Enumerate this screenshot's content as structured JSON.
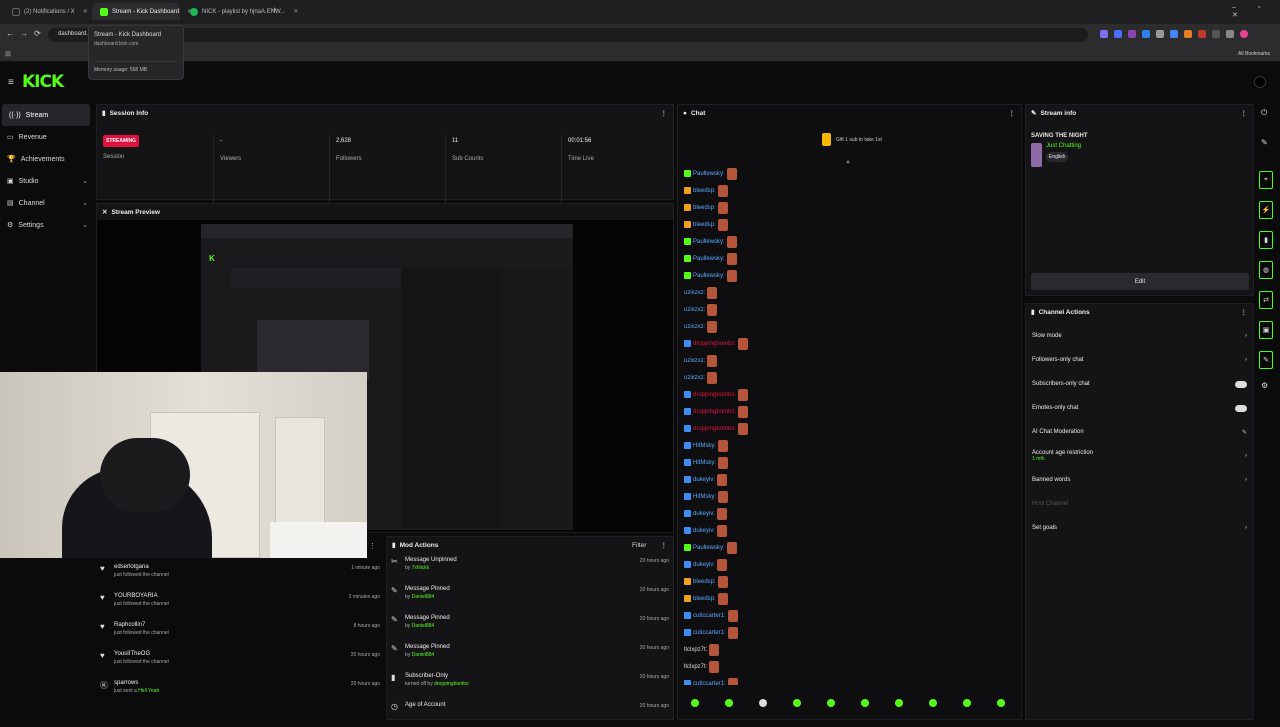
{
  "browser": {
    "tabs": [
      {
        "title": "(2) Notifications / X"
      },
      {
        "title": "Stream - Kick Dashboard"
      },
      {
        "title": "NICK - playlist by hjnaA.ENW..."
      }
    ],
    "url": "dashboard.ki",
    "bookmarks_label": "All Bookmarks",
    "tooltip": {
      "title": "Stream - Kick Dashboard",
      "url": "dashboard.kick.com",
      "memory": "Memory usage: 558 MB"
    }
  },
  "app": {
    "logo": "KICK"
  },
  "sidebar": {
    "items": [
      {
        "label": "Stream"
      },
      {
        "label": "Revenue"
      },
      {
        "label": "Achievements"
      },
      {
        "label": "Studio"
      },
      {
        "label": "Channel"
      },
      {
        "label": "Settings"
      }
    ]
  },
  "session": {
    "title": "Session Info",
    "status": "STREAMING",
    "stats": [
      {
        "value": "",
        "label": "Session"
      },
      {
        "value": "-",
        "label": "Viewers"
      },
      {
        "value": "2,628",
        "label": "Followers"
      },
      {
        "value": "11",
        "label": "Sub Counts"
      },
      {
        "value": "00:01:56",
        "label": "Time Live"
      }
    ]
  },
  "preview": {
    "title": "Stream Preview"
  },
  "activity": [
    {
      "name": "edserlotgana",
      "desc": "just followed the channel",
      "time": "1 minute ago"
    },
    {
      "name": "YOURBOYARIA",
      "desc": "just followed the channel",
      "time": "2 minutes ago"
    },
    {
      "name": "Raphcollin7",
      "desc": "just followed the channel",
      "time": "8 hours ago"
    },
    {
      "name": "YousIITheOG",
      "desc": "just followed the channel",
      "time": "20 hours ago"
    },
    {
      "name": "sparrows",
      "desc": "just sent a",
      "extra": "Hell Yeah",
      "time": "20 hours ago"
    }
  ],
  "mod_actions": {
    "title": "Mod Actions",
    "filter": "Filter",
    "items": [
      {
        "action": "Message Unpinned",
        "by_prefix": "by",
        "by": "7xNickk",
        "time": "20 hours ago"
      },
      {
        "action": "Message Pinned",
        "by_prefix": "by",
        "by": "Daniel884",
        "time": "20 hours ago"
      },
      {
        "action": "Message Pinned",
        "by_prefix": "by",
        "by": "Daniel884",
        "time": "20 hours ago"
      },
      {
        "action": "Message Pinned",
        "by_prefix": "by",
        "by": "Daniel884",
        "time": "20 hours ago"
      },
      {
        "action": "Subscriber-Only",
        "by_prefix": "turned off by",
        "by": "droppingbombs",
        "time": "20 hours ago"
      },
      {
        "action": "Age of Account",
        "by_prefix": "",
        "by": "",
        "time": "20 hours ago"
      }
    ]
  },
  "chat": {
    "title": "Chat",
    "gift": "Gift 1 sub to take 1st",
    "messages": [
      {
        "user": "Paullewsky:",
        "color": "#5aa9ff",
        "badge": "#53fc18"
      },
      {
        "user": "bleedsp:",
        "color": "#5aa9ff",
        "badge": "#f0a020"
      },
      {
        "user": "bleedsp:",
        "color": "#5aa9ff",
        "badge": "#f0a020"
      },
      {
        "user": "bleedsp:",
        "color": "#5aa9ff",
        "badge": "#f0a020"
      },
      {
        "user": "Paullewsky:",
        "color": "#5aa9ff",
        "badge": "#53fc18"
      },
      {
        "user": "Paullewsky:",
        "color": "#5aa9ff",
        "badge": "#53fc18"
      },
      {
        "user": "Paullewsky:",
        "color": "#5aa9ff",
        "badge": "#53fc18"
      },
      {
        "user": "uzixzxz:",
        "color": "#5aa9ff",
        "badge": ""
      },
      {
        "user": "uzixzxz:",
        "color": "#5aa9ff",
        "badge": ""
      },
      {
        "user": "uzixzxz:",
        "color": "#5aa9ff",
        "badge": ""
      },
      {
        "user": "droppingbombs:",
        "color": "#e0103f",
        "badge": "#3d8df5"
      },
      {
        "user": "uzixzxz:",
        "color": "#5aa9ff",
        "badge": ""
      },
      {
        "user": "uzixzxz:",
        "color": "#5aa9ff",
        "badge": ""
      },
      {
        "user": "droppingbombs:",
        "color": "#e0103f",
        "badge": "#3d8df5"
      },
      {
        "user": "droppingbombs:",
        "color": "#e0103f",
        "badge": "#3d8df5"
      },
      {
        "user": "droppingbombs:",
        "color": "#e0103f",
        "badge": "#3d8df5"
      },
      {
        "user": "HitMsky:",
        "color": "#5aa9ff",
        "badge": "#3d8df5"
      },
      {
        "user": "HitMsky:",
        "color": "#5aa9ff",
        "badge": "#3d8df5"
      },
      {
        "user": "dukeyiv:",
        "color": "#5aa9ff",
        "badge": "#3d8df5"
      },
      {
        "user": "HitMsky:",
        "color": "#5aa9ff",
        "badge": "#3d8df5"
      },
      {
        "user": "dukeyiv:",
        "color": "#5aa9ff",
        "badge": "#3d8df5"
      },
      {
        "user": "dukeyiv:",
        "color": "#5aa9ff",
        "badge": "#3d8df5"
      },
      {
        "user": "Paullewsky:",
        "color": "#5aa9ff",
        "badge": "#53fc18"
      },
      {
        "user": "dukeyiv:",
        "color": "#5aa9ff",
        "badge": "#3d8df5"
      },
      {
        "user": "bleedsp:",
        "color": "#5aa9ff",
        "badge": "#f0a020"
      },
      {
        "user": "bleedsp:",
        "color": "#5aa9ff",
        "badge": "#f0a020"
      },
      {
        "user": "cuticcarter1:",
        "color": "#5aa9ff",
        "badge": "#3d8df5"
      },
      {
        "user": "cuticcarter1:",
        "color": "#5aa9ff",
        "badge": "#3d8df5"
      },
      {
        "user": "ltclxpz7t:",
        "color": "#ddd",
        "badge": ""
      },
      {
        "user": "ltclxpz7t:",
        "color": "#ddd",
        "badge": ""
      },
      {
        "user": "cuticcarter1:",
        "color": "#5aa9ff",
        "badge": "#3d8df5"
      }
    ]
  },
  "stream_info": {
    "title": "Stream info",
    "stream_title": "SAVING THE NIGHT",
    "category": "Just Chatting",
    "language": "English",
    "edit": "Edit"
  },
  "channel_actions": {
    "title": "Channel Actions",
    "items": [
      {
        "label": "Slow mode",
        "sub": "",
        "control": "chevron"
      },
      {
        "label": "Followers-only chat",
        "sub": "",
        "control": "chevron"
      },
      {
        "label": "Subscribers-only chat",
        "sub": "",
        "control": "toggle"
      },
      {
        "label": "Emotes-only chat",
        "sub": "",
        "control": "toggle"
      },
      {
        "label": "AI Chat Moderation",
        "sub": "",
        "control": "edit"
      },
      {
        "label": "Account age restriction",
        "sub": "1 mth",
        "control": "chevron"
      },
      {
        "label": "Banned words",
        "sub": "",
        "control": "chevron"
      },
      {
        "label": "Host Channel",
        "sub": "",
        "control": "none"
      },
      {
        "label": "Set goals",
        "sub": "",
        "control": "chevron"
      }
    ]
  },
  "colors": {
    "accent": "#53fc18",
    "live": "#e0103f",
    "bg": "#0b0b0c",
    "panel": "#141416"
  }
}
